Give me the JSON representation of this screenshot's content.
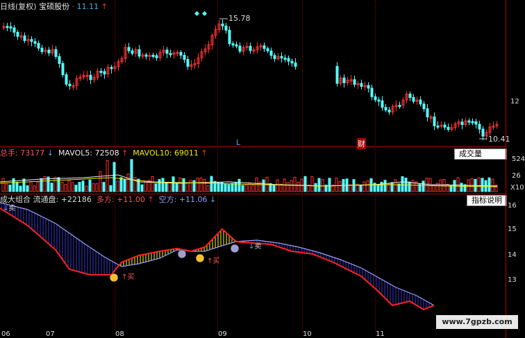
{
  "price_panel": {
    "period": "日线(复权)",
    "stock": "宝硕股份",
    "price": "11.11",
    "high_label": "15.78",
    "low_label": "10.41",
    "marker_l": "L",
    "marker_cai": "财",
    "axis_label": "12"
  },
  "volume_panel": {
    "total_label": "总手:",
    "total": "73177",
    "mavol5_label": "MAVOL5:",
    "mavol5": "72508",
    "mavol10_label": "MAVOL10:",
    "mavol10": "69011",
    "button": "成交量",
    "axis_top": "524",
    "axis_mid": "26",
    "axis_unit": "X10"
  },
  "indicator_panel": {
    "name": "成大组合",
    "float_label": "流通盘:",
    "float": "+22186",
    "long_label": "多方:",
    "long": "+11.00",
    "short_label": "空方:",
    "short": "+11.06",
    "button": "指标说明",
    "buy": "买",
    "sell": "卖",
    "axis": [
      "16",
      "15",
      "14",
      "13"
    ]
  },
  "x_axis": {
    "labels": [
      "06",
      "07",
      "08",
      "09",
      "10",
      "11"
    ]
  },
  "watermark": "www.7gpzb.com",
  "colors": {
    "up": "#ff3232",
    "down": "#54fcfc",
    "background": "#000000",
    "grid": "#b00000"
  }
}
